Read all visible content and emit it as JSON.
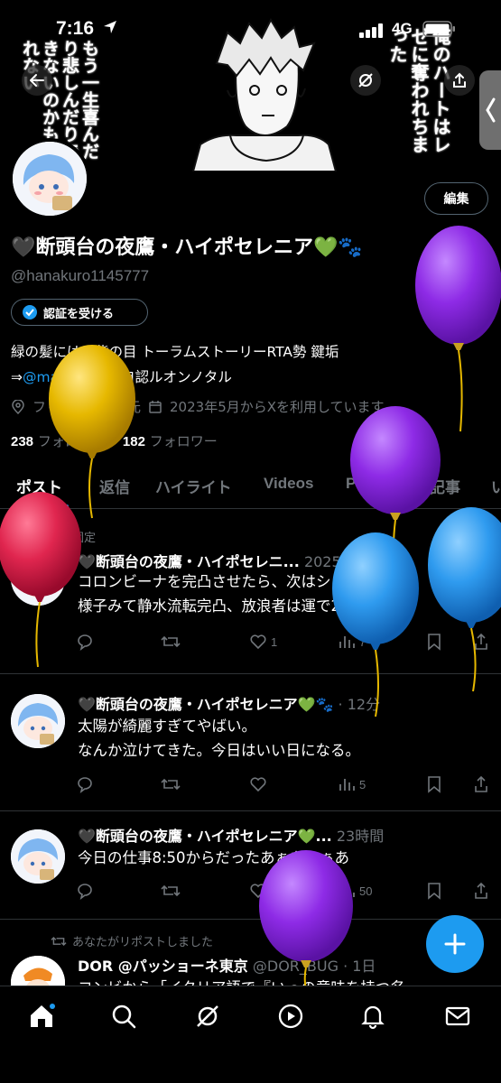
{
  "status": {
    "time": "7:16",
    "network": "4G"
  },
  "banner": {
    "left_text": "もう一生喜んだり悲しんだりできないのかもしれない",
    "right_text": "俺のハートはレゼに奪われちまった"
  },
  "profile": {
    "edit_label": "編集",
    "name": "🖤断頭台の夜鷹・ハイポセレニア💚🐾",
    "handle": "@hanakuro1145777",
    "verify_label": "認証を受ける",
    "bio_line1": "緑の髪には、紫の目 トーラムストーリーRTA勢 鍵垢",
    "bio_arrow": "⇒",
    "bio_mention": "@mayodaka_",
    "bio_rest": " 自認ルオンノタル",
    "location": "フリーナ様の足元",
    "joined": "2023年5月からXを利用しています",
    "following_count": "238",
    "following_label": "フォロー中",
    "followers_count": "182",
    "followers_label": "フォロワー"
  },
  "tabs": [
    "ポスト",
    "返信",
    "ハイライト",
    "Videos",
    "Photos",
    "記事",
    "い"
  ],
  "posts": [
    {
      "pinned_label": "固定",
      "name": "🖤断頭台の夜鷹・ハイポセレニ...",
      "time": "2025/11/21",
      "lines": [
        "コロンビーナを完凸させたら、次はシトラリ完凸、",
        "様子みて静水流転完凸、放浪者は運で2凸します。"
      ],
      "likes": "1",
      "views": "7"
    },
    {
      "name": "🖤断頭台の夜鷹・ハイポセレニア💚🐾",
      "time": "· 12分",
      "lines": [
        "太陽が綺麗すぎてやばい。",
        "なんか泣けてきた。今日はいい日になる。"
      ],
      "views": "5"
    },
    {
      "name": "🖤断頭台の夜鷹・ハイポセレニア💚...",
      "time": "23時間",
      "lines": [
        "今日の仕事8:50からだったあぁああぁあ"
      ],
      "views": "50"
    },
    {
      "repost_label": "あなたがリポストしました",
      "name": "DOR @パッショーネ東京",
      "handle": "@DOR_BUG · 1日",
      "lines": [
        "コンビから「イタリア語で『いっの意味を持つ名..."
      ]
    }
  ],
  "nav": [
    "home-icon",
    "search-icon",
    "grok-icon",
    "video-icon",
    "notifications-icon",
    "messages-icon"
  ],
  "colors": {
    "accent": "#1d9bf0",
    "background": "#000000",
    "balloon_purple": "#8a2be2",
    "balloon_yellow": "#e6b800",
    "balloon_red": "#e0264f",
    "balloon_blue": "#2f9bef"
  }
}
